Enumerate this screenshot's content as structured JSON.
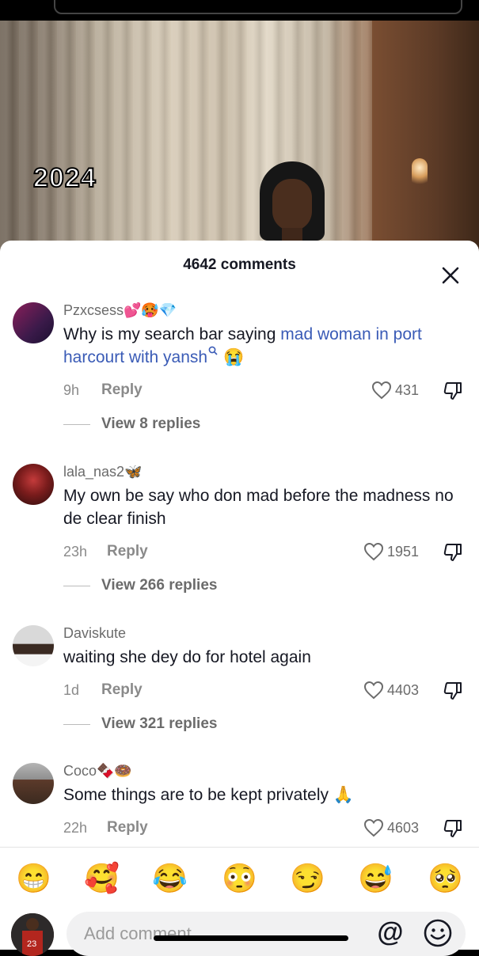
{
  "video": {
    "overlay_text": "2024"
  },
  "header": {
    "comments_count": "4642 comments"
  },
  "comments": [
    {
      "username": "Pzxcsess💕🥵💎",
      "text_plain": "Why is my search bar saying ",
      "text_link": "mad woman in port harcourt with yansh",
      "text_suffix": "😭",
      "time": "9h",
      "reply": "Reply",
      "likes": "431",
      "view_replies": "View 8 replies"
    },
    {
      "username": "lala_nas2🦋",
      "text": "My own be say who don mad before the madness no de clear finish",
      "time": "23h",
      "reply": "Reply",
      "likes": "1951",
      "view_replies": "View 266 replies"
    },
    {
      "username": "Daviskute",
      "text": "waiting she dey do for hotel again",
      "time": "1d",
      "reply": "Reply",
      "likes": "4403",
      "view_replies": "View 321 replies"
    },
    {
      "username": "Coco🍫🍩",
      "text": "Some things are to be kept privately 🙏",
      "time": "22h",
      "reply": "Reply",
      "likes": "4603"
    }
  ],
  "emoji_bar": [
    "😁",
    "🥰",
    "😂",
    "😳",
    "😏",
    "😅",
    "🥺"
  ],
  "composer": {
    "placeholder": "Add comment..."
  },
  "colors": {
    "link": "#3a5bb6",
    "text": "#161823",
    "muted": "#8a8a8a"
  }
}
